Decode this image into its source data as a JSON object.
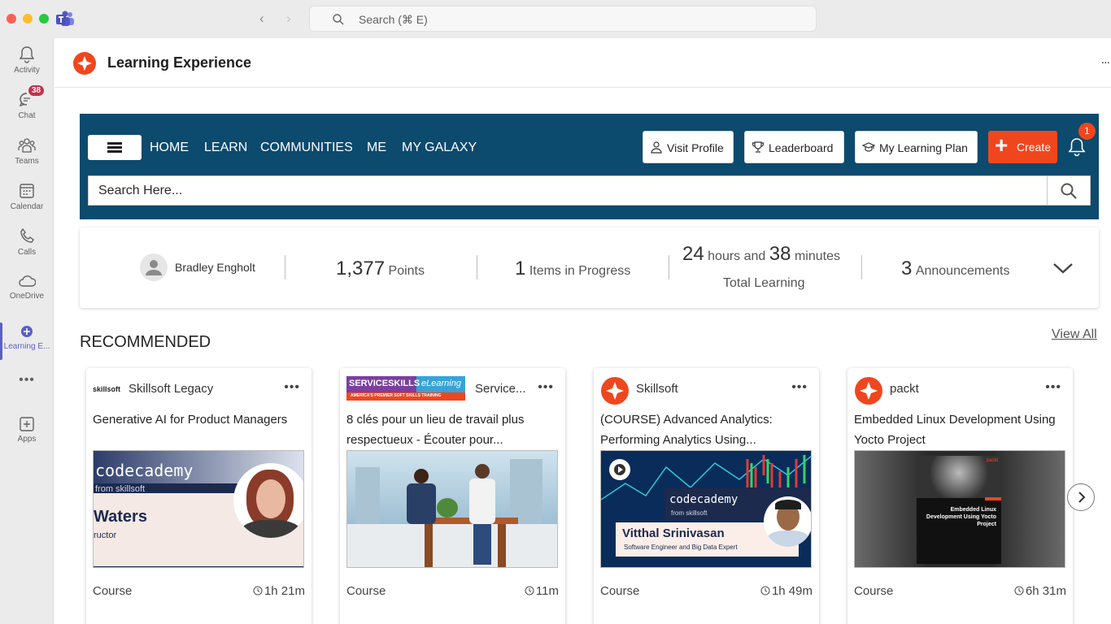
{
  "titlebar": {
    "search_placeholder": "Search (⌘ E)"
  },
  "rail": {
    "items": [
      {
        "label": "Activity",
        "icon": "bell-icon"
      },
      {
        "label": "Chat",
        "icon": "chat-icon",
        "badge": "38"
      },
      {
        "label": "Teams",
        "icon": "teams-icon"
      },
      {
        "label": "Calendar",
        "icon": "calendar-icon"
      },
      {
        "label": "Calls",
        "icon": "phone-icon"
      },
      {
        "label": "OneDrive",
        "icon": "cloud-icon"
      },
      {
        "label": "Learning E...",
        "icon": "learning-icon"
      },
      {
        "label": "Apps",
        "icon": "apps-icon"
      }
    ]
  },
  "app": {
    "title": "Learning Experience",
    "more": "..."
  },
  "nav": {
    "links": [
      "HOME",
      "LEARN",
      "COMMUNITIES",
      "ME",
      "MY GALAXY"
    ],
    "visit_profile": "Visit Profile",
    "leaderboard": "Leaderboard",
    "learning_plan": "My Learning Plan",
    "create": "Create",
    "notification_count": "1",
    "search_placeholder": "Search Here..."
  },
  "stats": {
    "user_name": "Bradley Engholt",
    "points_value": "1,377",
    "points_label": "Points",
    "progress_value": "1",
    "progress_label": "Items in Progress",
    "hours_value": "24",
    "hours_label": "hours and",
    "minutes_value": "38",
    "minutes_label": "minutes",
    "total_label": "Total Learning",
    "announce_value": "3",
    "announce_label": "Announcements"
  },
  "recommended": {
    "title": "RECOMMENDED",
    "view_all": "View All",
    "cards": [
      {
        "provider": "Skillsoft Legacy",
        "provider_logo_text": "skillsoft",
        "title": "Generative AI for Product Managers",
        "thumb_brand": "codecademy",
        "thumb_sub": "from skillsoft",
        "thumb_name": "Waters",
        "thumb_role": "ructor",
        "type": "Course",
        "duration": "1h 21m"
      },
      {
        "provider": "Service...",
        "provider_logo_text": "SERVICESKILLS",
        "provider_logo_text2": "eLearning",
        "provider_logo_sub": "AMERICA'S PREMIER SOFT SKILLS TRAINING",
        "title": "8 clés pour un lieu de travail plus respectueux - Écouter pour...",
        "type": "Course",
        "duration": "11m"
      },
      {
        "provider": "Skillsoft",
        "title": "(COURSE) Advanced Analytics: Performing Analytics Using...",
        "thumb_brand": "codecademy",
        "thumb_sub": "from skillsoft",
        "thumb_name": "Vitthal Srinivasan",
        "thumb_role": "Software Engineer and Big Data Expert",
        "type": "Course",
        "duration": "1h 49m"
      },
      {
        "provider": "packt",
        "title": "Embedded Linux Development Using Yocto Project",
        "thumb_brand": "packt",
        "thumb_book": "Embedded Linux Development Using Yocto Project",
        "type": "Course",
        "duration": "6h 31m"
      }
    ]
  },
  "colors": {
    "navy": "#0c4a6e",
    "accent": "#f0461e",
    "teams_purple": "#5b5fc7"
  }
}
